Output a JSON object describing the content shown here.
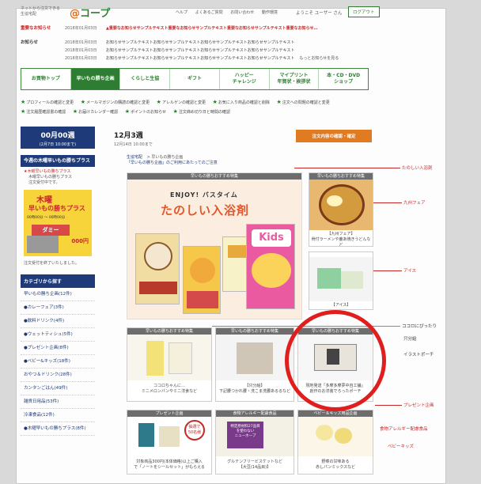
{
  "header": {
    "tagline": "ネットから注文できる 生協宅配",
    "logo_at": "@",
    "logo_text": "コープ",
    "links": [
      "ヘルプ",
      "よくあるご質問",
      "お問い合わせ",
      "動作環境"
    ],
    "greeting": "ようこそ ユーザー さん",
    "logout": "ログアウト"
  },
  "notices": {
    "urgent_label": "重要なお知らせ",
    "urgent_date": "2018年01月03日",
    "urgent_text": "▲重要なお知らせサンプルテキスト重要なお知らせサンプルテキスト重要なお知らせサンプルテキスト重要なお知らせ…",
    "normal_label": "お知らせ",
    "rows": [
      {
        "date": "2018年01月03日",
        "text": "お知らせサンプルテキストお知らせサンプルテキストお知らせサンプルテキストお知らせサンプルテキスト",
        "more": ""
      },
      {
        "date": "2018年01月03日",
        "text": "お知らせサンプルテキストお知らせサンプルテキストお知らせサンプルテキストお知らせサンプルテキスト",
        "more": ""
      },
      {
        "date": "2018年01月03日",
        "text": "お知らせサンプルテキストお知らせサンプルテキストお知らせサンプルテキストお知らせサンプルテキスト",
        "more": "もっとお知らせを見る"
      }
    ]
  },
  "nav": [
    {
      "label": "お買物トップ",
      "active": false
    },
    {
      "label": "早いもの勝ち企画",
      "active": true
    },
    {
      "label": "くらしと生協",
      "active": false
    },
    {
      "label": "ギフト",
      "active": false
    },
    {
      "label": "ハッピー\nチャレンジ",
      "active": false
    },
    {
      "label": "マイプリント\n年賀状・挨拶状",
      "active": false
    },
    {
      "label": "本・CD・DVD\nショップ",
      "active": false
    }
  ],
  "quicklinks": [
    "プロフィールの確認と変更",
    "メールマガジンの購読の確認と変更",
    "アレルゲンの確認と変更",
    "お気に入り商品の確認と削除",
    "注文への問題の確認と変更",
    "注文履歴確認書の確認",
    "お届けカレンダー確認",
    "ポイントのお知らせ",
    "注文締め切り日と時間の確認"
  ],
  "week": {
    "current_title": "00月00週",
    "current_sub": "(2月7日 10:00まで)",
    "next_title": "12月3週",
    "next_sub": "12月14日 10:00まで",
    "order_button": "注文内容の確認・確定"
  },
  "sidebar": {
    "head": "今週の木曜早いもの勝ちプラス",
    "promo1": "★木曜早いもの勝ちプラス",
    "promo2": "木曜早いもの勝ちプラス",
    "promo3": "注文受付中です。",
    "banner_title": "木曜",
    "banner_sub": "早いもの勝ちプラス",
    "banner_time": "00時00分 ～ 00時00分",
    "banner_dummy": "ダミー",
    "banner_price": "000円",
    "note": "注文受付を終了いたしました。",
    "cat_head": "カテゴリから探す",
    "categories": [
      "早いもの勝ち企画(12件)",
      "●カレーフェア(3件)",
      "●飲料ドリンク(4件)",
      "●ウェットティシュ(5件)",
      "●プレゼント企画(8件)",
      "●ベビー&キッズ(18件)",
      "おやつ＆ドリンク(28件)",
      "カンタンごはん(49件)",
      "雑貨日用品(53件)",
      "冷凍食品(12件)",
      "●木曜早いもの勝ちプラス(8件)"
    ]
  },
  "breadcrumb": {
    "root": "生協宅配",
    "sep": "> ",
    "current": "早いもの勝ち企画",
    "desc": "「早いもの勝ち企画」のご利用にあたってのご注意"
  },
  "hero": {
    "header": "早いもの勝ちおすすめ特集",
    "enjoy": "ENJOY! バスタイム",
    "title": "たのしい入浴剤"
  },
  "cards": {
    "top_header": "早いもの勝ちおすすめ特集",
    "curry_caption": "【九州フェア】\n骨付ラーメンや鹿あ焼きうどんなど",
    "ice_caption": "【アイス】",
    "c1_header": "早いもの勝ちおすすめ特集",
    "c1_caption": "ココロちゃんに…\nミニメロンパンやミニ洋食など",
    "c2_header": "早いもの勝ちおすすめ特集",
    "c2_caption": "【只分給】\n下記腰つかれ腰・洗こま洗腰あるるなど",
    "c3_header": "早いもの勝ちおすすめ特集",
    "c3_caption": "現地発送「多摩多摩夢中自工舗」\n創作のお洋装でろったポーチ",
    "p1_header": "プレゼント企画",
    "p1_caption": "対象商品300円(本体価格)以上ご購入\nで「ノートをシールセット」がもらえる",
    "p2_header": "食物アレルギー配慮食品",
    "p2_caption": "グルテンフリービスケットなど\n【大豆(14品目)】",
    "p2_img_text": "特定原材料27品目\nを使わない\nニューホープ",
    "p3_header": "ベビー＆キッズ用品企画",
    "p3_caption": "野菜の甘味ある\n赤しパンミックスなど",
    "sticker_text": "抽選で\n50名様"
  },
  "callouts": {
    "bath": "たのしい入浴剤",
    "kyushu": "九州フェア",
    "ice": "アイス",
    "kokoro": "ココロにぴったり",
    "iketsu": "只分給",
    "illust": "イラストポーチ",
    "present": "プレゼント企画",
    "allergy": "食物アレルギー配慮食品",
    "baby": "ベビーキッズ"
  },
  "colors": {
    "brand_green": "#2e7d32",
    "navy": "#1f3a78",
    "accent_orange": "#e07b22",
    "alert_red": "#c62828",
    "circle_red": "#e01e1e"
  }
}
